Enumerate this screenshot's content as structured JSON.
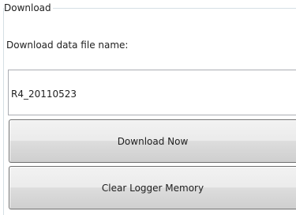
{
  "group": {
    "title": "Download"
  },
  "file_name": {
    "label": "Download data file name:",
    "value": "R4_20110523"
  },
  "buttons": {
    "download_now": "Download Now",
    "clear_memory": "Clear Logger Memory"
  }
}
